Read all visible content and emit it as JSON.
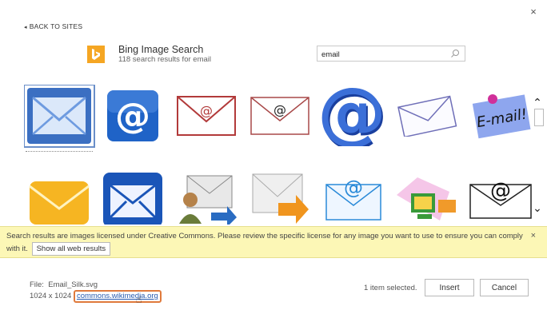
{
  "dialog": {
    "close_glyph": "×"
  },
  "nav": {
    "back_label": "BACK TO SITES",
    "back_arrow": "◂"
  },
  "provider": {
    "name": "Bing Image Search",
    "count_text": "118 search results for email",
    "logo": "bing-logo",
    "accent": "#f5a623"
  },
  "search": {
    "value": "email",
    "placeholder": ""
  },
  "results": [
    {
      "icon": "envelope-blue-icon",
      "selected": true
    },
    {
      "icon": "at-sign-blue-tile-icon",
      "selected": false
    },
    {
      "icon": "envelope-red-at-icon",
      "selected": false
    },
    {
      "icon": "envelope-at-outline-icon",
      "selected": false
    },
    {
      "icon": "at-sign-3d-blue-icon",
      "selected": false
    },
    {
      "icon": "envelope-white-blue-icon",
      "selected": false
    },
    {
      "icon": "email-sticky-note-icon",
      "selected": false
    },
    {
      "icon": "envelope-yellow-icon",
      "selected": false
    },
    {
      "icon": "envelope-blue-tile-icon",
      "selected": false
    },
    {
      "icon": "users-envelope-arrow-icon",
      "selected": false
    },
    {
      "icon": "envelope-orange-arrow-icon",
      "selected": false
    },
    {
      "icon": "envelope-blue-at-icon",
      "selected": false
    },
    {
      "icon": "computer-mail-icon",
      "selected": false
    },
    {
      "icon": "envelope-black-at-icon",
      "selected": false
    }
  ],
  "notice": {
    "text": "Search results are images licensed under Creative Commons. Please review the specific license for any image you want to use to ensure you can comply with it.",
    "button_label": "Show all web results",
    "close_glyph": "×",
    "bg_color": "#fcf7b6"
  },
  "footer": {
    "file_label": "File:",
    "file_name": "Email_Silk.svg",
    "dimensions": "1024 x 1024",
    "source_link": "commons.wikimedia.org",
    "selection_text": "1 item selected.",
    "insert_label": "Insert",
    "cancel_label": "Cancel"
  },
  "colors": {
    "link": "#2a5db0",
    "highlight_box": "#e07a3c",
    "selection": "#6a8fc9"
  }
}
